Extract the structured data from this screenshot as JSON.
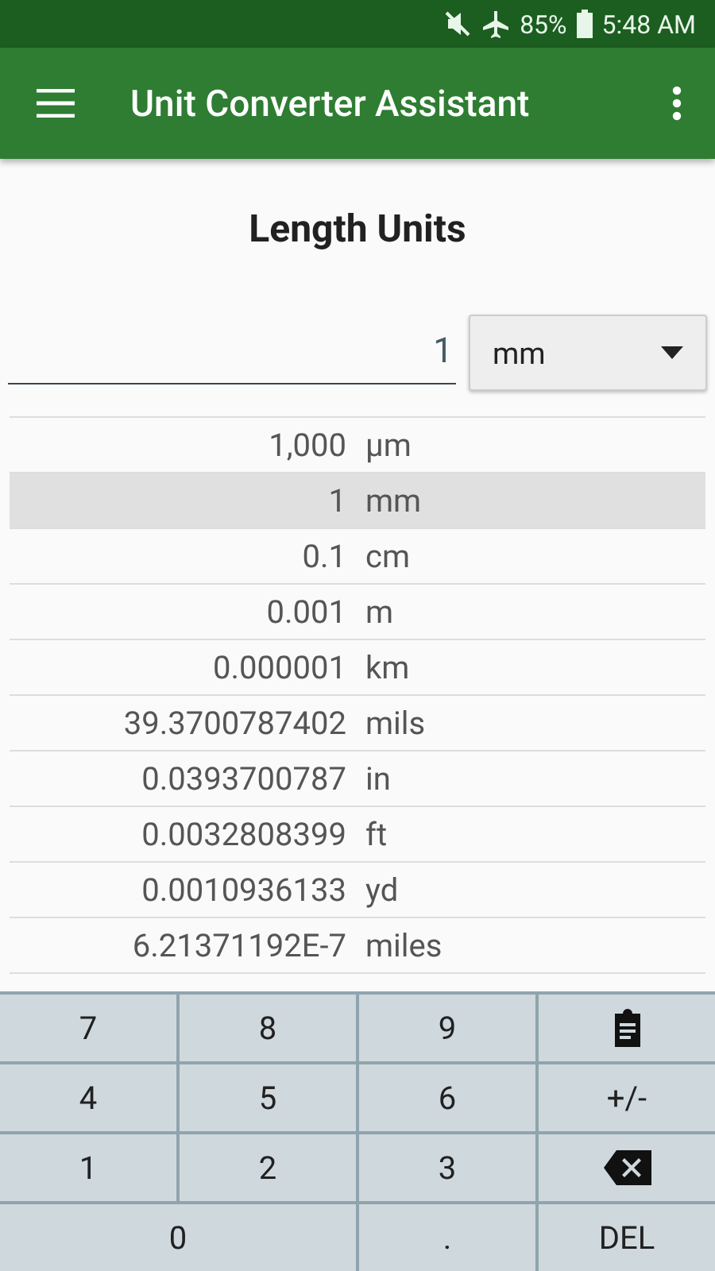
{
  "status_bar": {
    "battery": "85%",
    "time": "5:48 AM"
  },
  "app_bar": {
    "title": "Unit Converter Assistant"
  },
  "heading": "Length Units",
  "input": {
    "value": "1"
  },
  "unit_dropdown": {
    "value": "mm"
  },
  "results": [
    {
      "value": "1,000",
      "unit": "µm",
      "selected": false
    },
    {
      "value": "1",
      "unit": "mm",
      "selected": true
    },
    {
      "value": "0.1",
      "unit": "cm",
      "selected": false
    },
    {
      "value": "0.001",
      "unit": "m",
      "selected": false
    },
    {
      "value": "0.000001",
      "unit": "km",
      "selected": false
    },
    {
      "value": "39.3700787402",
      "unit": "mils",
      "selected": false
    },
    {
      "value": "0.0393700787",
      "unit": "in",
      "selected": false
    },
    {
      "value": "0.0032808399",
      "unit": "ft",
      "selected": false
    },
    {
      "value": "0.0010936133",
      "unit": "yd",
      "selected": false
    },
    {
      "value": "6.21371192E-7",
      "unit": "miles",
      "selected": false
    }
  ],
  "keypad": [
    {
      "kind": "text",
      "label": "7"
    },
    {
      "kind": "text",
      "label": "8"
    },
    {
      "kind": "text",
      "label": "9"
    },
    {
      "kind": "paste"
    },
    {
      "kind": "text",
      "label": "4"
    },
    {
      "kind": "text",
      "label": "5"
    },
    {
      "kind": "text",
      "label": "6"
    },
    {
      "kind": "text",
      "label": "+/-"
    },
    {
      "kind": "text",
      "label": "1"
    },
    {
      "kind": "text",
      "label": "2"
    },
    {
      "kind": "text",
      "label": "3"
    },
    {
      "kind": "backspace"
    },
    {
      "kind": "text",
      "label": "0",
      "wide": true
    },
    {
      "kind": "text",
      "label": "."
    },
    {
      "kind": "text",
      "label": "DEL"
    }
  ]
}
